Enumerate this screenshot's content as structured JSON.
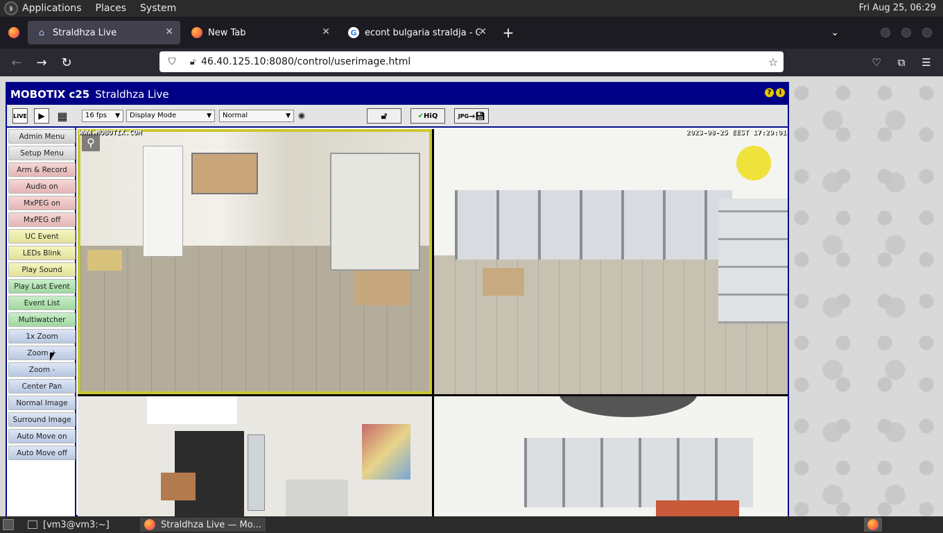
{
  "topbar": {
    "menus": [
      "Applications",
      "Places",
      "System"
    ],
    "clock": "Fri Aug 25, 06:29"
  },
  "tabs": [
    {
      "label": "Straldhza Live",
      "icon": "camera-icon",
      "active": true
    },
    {
      "label": "New Tab",
      "icon": "firefox-icon",
      "active": false
    },
    {
      "label": "econt bulgaria straldja - Goo",
      "icon": "google-icon",
      "active": false
    }
  ],
  "navbar": {
    "url": "46.40.125.10:8080/control/userimage.html"
  },
  "app": {
    "brand": "MOBOTIX c25",
    "title": "Straldhza Live",
    "toolbar": {
      "live_label": "LIVE",
      "fps": "16 fps",
      "display_mode": "Display Mode",
      "quality": "Normal",
      "hiq_label": "HiQ",
      "jpg_label": "JPG"
    },
    "sidebar": [
      {
        "label": "Admin Menu",
        "color": "gray"
      },
      {
        "label": "Setup Menu",
        "color": "gray"
      },
      {
        "label": "Arm & Record",
        "color": "red"
      },
      {
        "label": "Audio on",
        "color": "red"
      },
      {
        "label": "MxPEG on",
        "color": "red"
      },
      {
        "label": "MxPEG off",
        "color": "red"
      },
      {
        "label": "UC Event",
        "color": "yel"
      },
      {
        "label": "LEDs Blink",
        "color": "yel"
      },
      {
        "label": "Play Sound",
        "color": "yel"
      },
      {
        "label": "Play Last Event",
        "color": "grn"
      },
      {
        "label": "Event List",
        "color": "grn"
      },
      {
        "label": "Multiwatcher",
        "color": "grn"
      },
      {
        "label": "1x Zoom",
        "color": "blu"
      },
      {
        "label": "Zoom +",
        "color": "blu"
      },
      {
        "label": "Zoom -",
        "color": "blu"
      },
      {
        "label": "Center Pan",
        "color": "blu"
      },
      {
        "label": "Normal Image",
        "color": "blu"
      },
      {
        "label": "Surround Image",
        "color": "blu"
      },
      {
        "label": "Auto Move on",
        "color": "blu"
      },
      {
        "label": "Auto Move off",
        "color": "blu"
      }
    ],
    "osd": {
      "watermark": "WWW.MOBOTIX.COM",
      "timestamp": "2023-08-25 EEST 17:29:01"
    }
  },
  "taskbar": {
    "items": [
      "[vm3@vm3:~]",
      "Straldhza Live — Mo..."
    ]
  },
  "colors": {
    "mobotix_blue": "#000087",
    "firefox_chrome": "#1c1b22",
    "urlbar": "#ffffff"
  }
}
